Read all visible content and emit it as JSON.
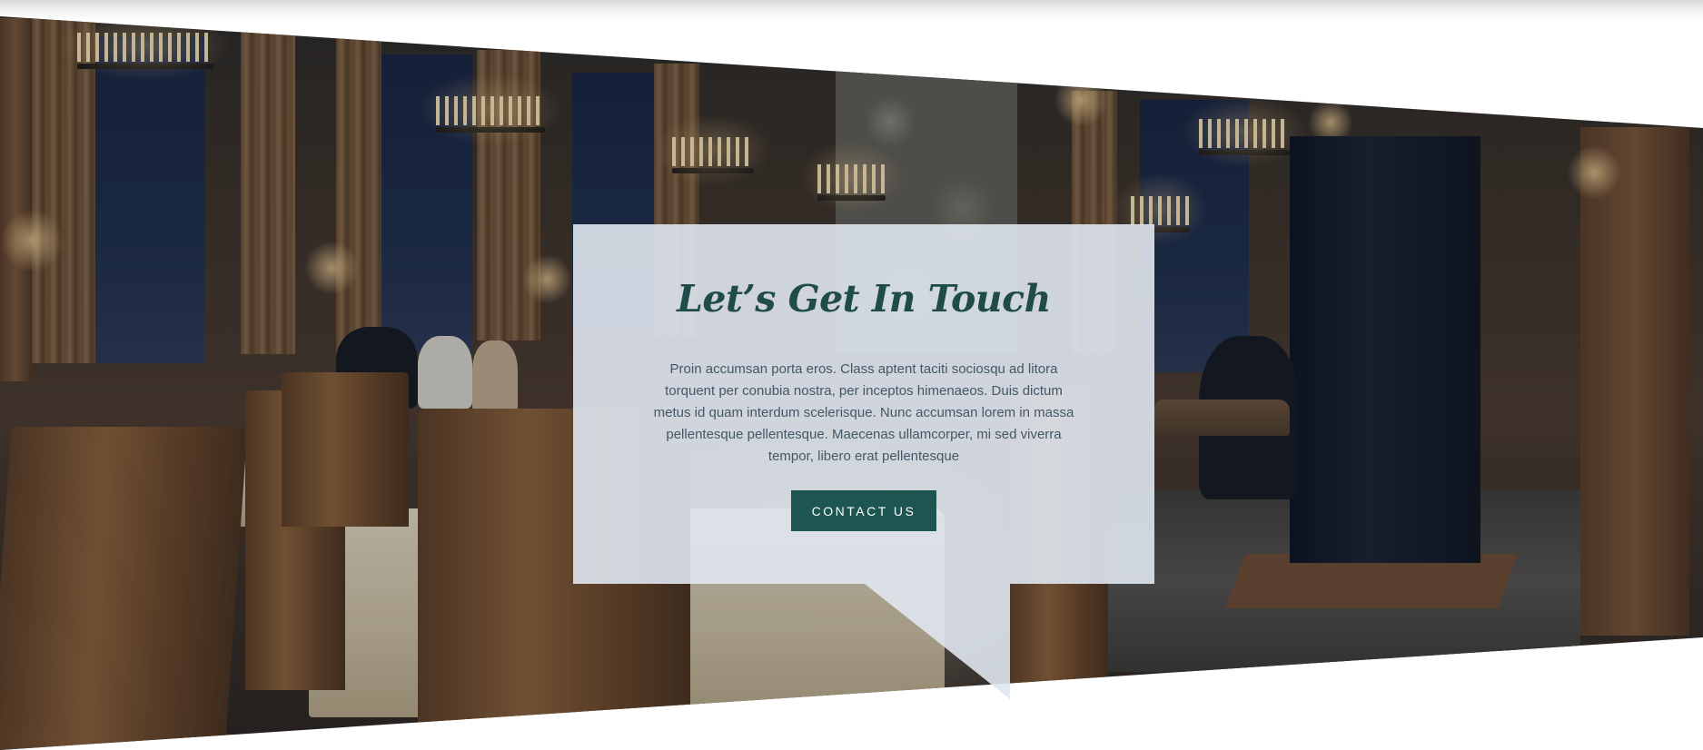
{
  "section": {
    "title": "Let’s Get In Touch",
    "description": "Proin accumsan porta eros. Class aptent taciti sociosqu ad litora torquent per conubia nostra, per inceptos himenaeos. Duis dictum metus id quam interdum scelerisque. Nunc accumsan lorem in massa pellentesque pellentesque. Maecenas ullamcorper, mi sed viverra tempor, libero erat pellentesque",
    "button_label": "CONTACT US"
  },
  "colors": {
    "accent": "#1d5550",
    "title": "#1f4c4a",
    "card_background": "#e0e7f0",
    "body_text": "#445766"
  },
  "background_image": {
    "subject": "candle-lit-dining-hall-photo"
  }
}
